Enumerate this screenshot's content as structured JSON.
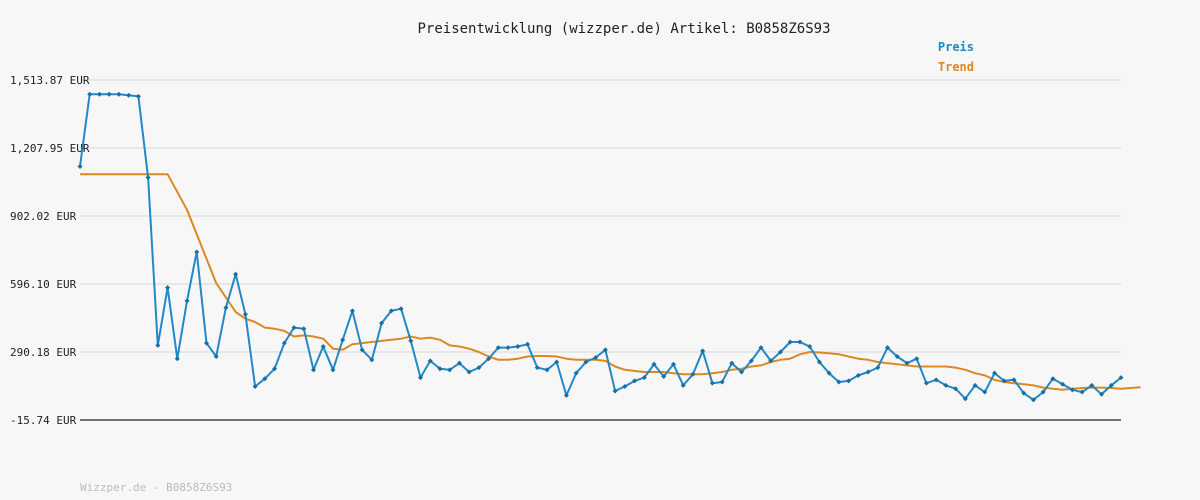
{
  "chart_data": {
    "type": "line",
    "title": "Preisentwicklung (wizzper.de) Artikel: B0858Z6S93",
    "xlabel": "",
    "ylabel": "",
    "ylim": [
      -15.74,
      1513.87
    ],
    "yticks": [
      "1,513.87 EUR",
      "1,207.95 EUR",
      "902.02 EUR",
      "596.10 EUR",
      "290.18 EUR",
      "-15.74 EUR"
    ],
    "ytick_values": [
      1513.87,
      1207.95,
      902.02,
      596.1,
      290.18,
      -15.74
    ],
    "grid": true,
    "legend_position": "top-right",
    "series": [
      {
        "name": "Preis",
        "color": "#2288c8",
        "markers": true,
        "values": [
          1125,
          1450,
          1450,
          1450,
          1450,
          1445,
          1440,
          1075,
          320,
          580,
          260,
          520,
          740,
          330,
          270,
          490,
          640,
          460,
          135,
          170,
          215,
          330,
          400,
          395,
          210,
          315,
          210,
          345,
          475,
          300,
          255,
          420,
          475,
          485,
          340,
          175,
          250,
          215,
          210,
          240,
          200,
          220,
          260,
          310,
          310,
          315,
          325,
          220,
          210,
          245,
          95,
          195,
          245,
          265,
          300,
          115,
          135,
          160,
          175,
          235,
          180,
          235,
          140,
          190,
          295,
          150,
          155,
          240,
          200,
          250,
          310,
          250,
          290,
          335,
          335,
          315,
          245,
          195,
          155,
          160,
          185,
          200,
          220,
          310,
          270,
          240,
          260,
          150,
          165,
          140,
          125,
          80,
          140,
          110,
          195,
          160,
          165,
          105,
          75,
          110,
          170,
          145,
          120,
          110,
          140,
          100,
          140,
          175
        ]
      },
      {
        "name": "Trend",
        "color": "#dd8822",
        "markers": false,
        "points": [
          [
            0,
            1090
          ],
          [
            9,
            1090
          ],
          [
            11,
            930
          ],
          [
            14,
            600
          ],
          [
            16,
            470
          ],
          [
            17,
            440
          ],
          [
            18,
            425
          ],
          [
            19,
            400
          ],
          [
            20,
            395
          ],
          [
            21,
            385
          ],
          [
            22,
            360
          ],
          [
            23,
            365
          ],
          [
            24,
            360
          ],
          [
            25,
            350
          ],
          [
            26,
            305
          ],
          [
            27,
            300
          ],
          [
            28,
            325
          ],
          [
            29,
            330
          ],
          [
            30,
            335
          ],
          [
            31,
            340
          ],
          [
            32,
            345
          ],
          [
            33,
            350
          ],
          [
            34,
            360
          ],
          [
            35,
            350
          ],
          [
            36,
            355
          ],
          [
            37,
            345
          ],
          [
            38,
            320
          ],
          [
            39,
            315
          ],
          [
            40,
            305
          ],
          [
            41,
            290
          ],
          [
            42,
            270
          ],
          [
            43,
            255
          ],
          [
            44,
            255
          ],
          [
            45,
            260
          ],
          [
            46,
            270
          ],
          [
            47,
            272
          ],
          [
            48,
            272
          ],
          [
            49,
            270
          ],
          [
            50,
            260
          ],
          [
            51,
            255
          ],
          [
            52,
            255
          ],
          [
            53,
            255
          ],
          [
            54,
            250
          ],
          [
            55,
            225
          ],
          [
            56,
            210
          ],
          [
            57,
            205
          ],
          [
            58,
            200
          ],
          [
            59,
            200
          ],
          [
            60,
            200
          ],
          [
            61,
            195
          ],
          [
            62,
            190
          ],
          [
            63,
            190
          ],
          [
            64,
            190
          ],
          [
            65,
            195
          ],
          [
            66,
            200
          ],
          [
            67,
            210
          ],
          [
            68,
            215
          ],
          [
            69,
            225
          ],
          [
            70,
            230
          ],
          [
            71,
            245
          ],
          [
            72,
            255
          ],
          [
            73,
            260
          ],
          [
            74,
            280
          ],
          [
            75,
            290
          ],
          [
            76,
            288
          ],
          [
            77,
            285
          ],
          [
            78,
            280
          ],
          [
            79,
            270
          ],
          [
            80,
            260
          ],
          [
            81,
            255
          ],
          [
            82,
            245
          ],
          [
            83,
            240
          ],
          [
            84,
            235
          ],
          [
            85,
            230
          ],
          [
            86,
            225
          ],
          [
            87,
            225
          ],
          [
            88,
            225
          ],
          [
            89,
            225
          ],
          [
            90,
            220
          ],
          [
            91,
            210
          ],
          [
            92,
            195
          ],
          [
            93,
            185
          ],
          [
            94,
            165
          ],
          [
            95,
            155
          ],
          [
            96,
            150
          ],
          [
            97,
            145
          ],
          [
            98,
            140
          ],
          [
            99,
            130
          ],
          [
            100,
            125
          ],
          [
            101,
            120
          ],
          [
            102,
            125
          ],
          [
            103,
            128
          ],
          [
            104,
            130
          ],
          [
            105,
            130
          ],
          [
            106,
            128
          ],
          [
            107,
            125
          ],
          [
            108,
            128
          ],
          [
            109,
            132
          ]
        ]
      }
    ]
  },
  "footer": "Wizzper.de - B0858Z6S93"
}
